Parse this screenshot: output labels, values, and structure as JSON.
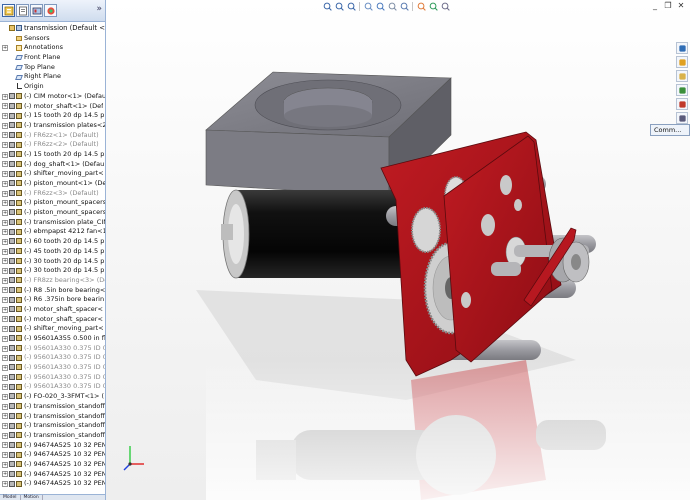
{
  "panel": {
    "tabs": [
      {
        "name": "feature-manager-tab-icon"
      },
      {
        "name": "property-manager-tab-icon"
      },
      {
        "name": "configuration-manager-tab-icon"
      },
      {
        "name": "display-manager-tab-icon"
      }
    ],
    "more": "»",
    "bottom_tabs": [
      "Model",
      "Motion"
    ]
  },
  "tree": [
    {
      "label": "transmission  (Default <Displa",
      "top": true,
      "exp": "",
      "icon": "assembly"
    },
    {
      "label": "Sensors",
      "exp": "",
      "icon": "folder"
    },
    {
      "label": "Annotations",
      "exp": "+",
      "icon": "annot"
    },
    {
      "label": "Front Plane",
      "exp": "",
      "icon": "plane"
    },
    {
      "label": "Top Plane",
      "exp": "",
      "icon": "plane"
    },
    {
      "label": "Right Plane",
      "exp": "",
      "icon": "plane"
    },
    {
      "label": "Origin",
      "exp": "",
      "icon": "origin"
    },
    {
      "label": "(-) CIM motor<1> (Default",
      "exp": "+",
      "icon": "part"
    },
    {
      "label": "(-) motor_shaft<1> (Def",
      "exp": "+",
      "icon": "part"
    },
    {
      "label": "(-) 15 tooth 20 dp 14.5 p",
      "exp": "+",
      "icon": "part"
    },
    {
      "label": "(-) transmission plates<2",
      "exp": "+",
      "icon": "part"
    },
    {
      "label": "(-) FR6zz<1> (Default)",
      "exp": "+",
      "icon": "part",
      "dim": true
    },
    {
      "label": "(-) FR6zz<2> (Default)",
      "exp": "+",
      "icon": "part",
      "dim": true
    },
    {
      "label": "(-) 15 tooth 20 dp 14.5 p",
      "exp": "+",
      "icon": "part"
    },
    {
      "label": "(-) dog_shaft<1> (Defau",
      "exp": "+",
      "icon": "part"
    },
    {
      "label": "(-) shifter_moving_part<",
      "exp": "+",
      "icon": "part"
    },
    {
      "label": "(-) piston_mount<1> (De",
      "exp": "+",
      "icon": "part"
    },
    {
      "label": "(-) FR6zz<3> (Default)",
      "exp": "+",
      "icon": "part",
      "dim": true
    },
    {
      "label": "(-) piston_mount_spacers",
      "exp": "+",
      "icon": "part"
    },
    {
      "label": "(-) piston_mount_spacers",
      "exp": "+",
      "icon": "part"
    },
    {
      "label": "(-) transmission plate_CIM",
      "exp": "+",
      "icon": "part"
    },
    {
      "label": "(-) ebmpapst 4212 fan<1",
      "exp": "+",
      "icon": "part"
    },
    {
      "label": "(-) 60 tooth 20 dp 14.5 p",
      "exp": "+",
      "icon": "part"
    },
    {
      "label": "(-) 45 tooth 20 dp 14.5 p",
      "exp": "+",
      "icon": "part"
    },
    {
      "label": "(-) 30 tooth 20 dp 14.5 p",
      "exp": "+",
      "icon": "part"
    },
    {
      "label": "(-) 30 tooth 20 dp 14.5 p",
      "exp": "+",
      "icon": "part"
    },
    {
      "label": "(-) FR8zz bearing<3> (Defa",
      "exp": "+",
      "icon": "part",
      "dim": true
    },
    {
      "label": "(-) R8 .5in bore bearing<",
      "exp": "+",
      "icon": "part"
    },
    {
      "label": "(-) R6 .375in bore bearin",
      "exp": "+",
      "icon": "part"
    },
    {
      "label": "(-) motor_shaft_spacer<",
      "exp": "+",
      "icon": "part"
    },
    {
      "label": "(-) motor_shaft_spacer<",
      "exp": "+",
      "icon": "part"
    },
    {
      "label": "(-) shifter_moving_part<",
      "exp": "+",
      "icon": "part"
    },
    {
      "label": "(-) 95601A355 0.500 in fl",
      "exp": "+",
      "icon": "part"
    },
    {
      "label": "(-) 95601A330  0.375 ID 0.5",
      "exp": "+",
      "icon": "part",
      "dim": true
    },
    {
      "label": "(-) 95601A330  0.375 ID 0.5",
      "exp": "+",
      "icon": "part",
      "dim": true
    },
    {
      "label": "(-) 95601A330  0.375 ID 0.5",
      "exp": "+",
      "icon": "part",
      "dim": true
    },
    {
      "label": "(-) 95601A330  0.375 ID 0.5",
      "exp": "+",
      "icon": "part",
      "dim": true
    },
    {
      "label": "(-) 95601A330  0.375 ID 0.5",
      "exp": "+",
      "icon": "part",
      "dim": true
    },
    {
      "label": "(-) FO-020_3-3FMT<1> (",
      "exp": "+",
      "icon": "part"
    },
    {
      "label": "(-) transmission_standoff",
      "exp": "+",
      "icon": "part"
    },
    {
      "label": "(-) transmission_standoff",
      "exp": "+",
      "icon": "part"
    },
    {
      "label": "(-) transmission_standoff",
      "exp": "+",
      "icon": "part"
    },
    {
      "label": "(-) transmission_standoff",
      "exp": "+",
      "icon": "part"
    },
    {
      "label": "(-) 94674A525 10 32 PEN",
      "exp": "+",
      "icon": "part"
    },
    {
      "label": "(-) 94674A525 10 32 PEN",
      "exp": "+",
      "icon": "part"
    },
    {
      "label": "(-) 94674A525 10 32 PEN",
      "exp": "+",
      "icon": "part"
    },
    {
      "label": "(-) 94674A525 10 32 PEN",
      "exp": "+",
      "icon": "part"
    },
    {
      "label": "(-) 94674A525 10 32 PEN",
      "exp": "+",
      "icon": "part"
    }
  ],
  "hud": [
    "zoom-to-fit-icon",
    "zoom-area-icon",
    "previous-view-icon",
    "section-view-icon",
    "view-orientation-icon",
    "display-style-icon",
    "hide-show-icon",
    "edit-appearance-icon",
    "apply-scene-icon",
    "view-settings-icon"
  ],
  "window_controls": {
    "minimize": "_",
    "restore": "❐",
    "close": "✕"
  },
  "task_pane": [
    "resources-icon",
    "design-library-icon",
    "file-explorer-icon",
    "view-palette-icon",
    "appearances-icon",
    "custom-properties-icon"
  ],
  "comm_label": "Comm...",
  "colors": {
    "plate": "#b0141b",
    "motor": "#111111",
    "fan": "#8c8c94",
    "gear": "#d8d8d8",
    "standoff": "#a0a0a6"
  }
}
